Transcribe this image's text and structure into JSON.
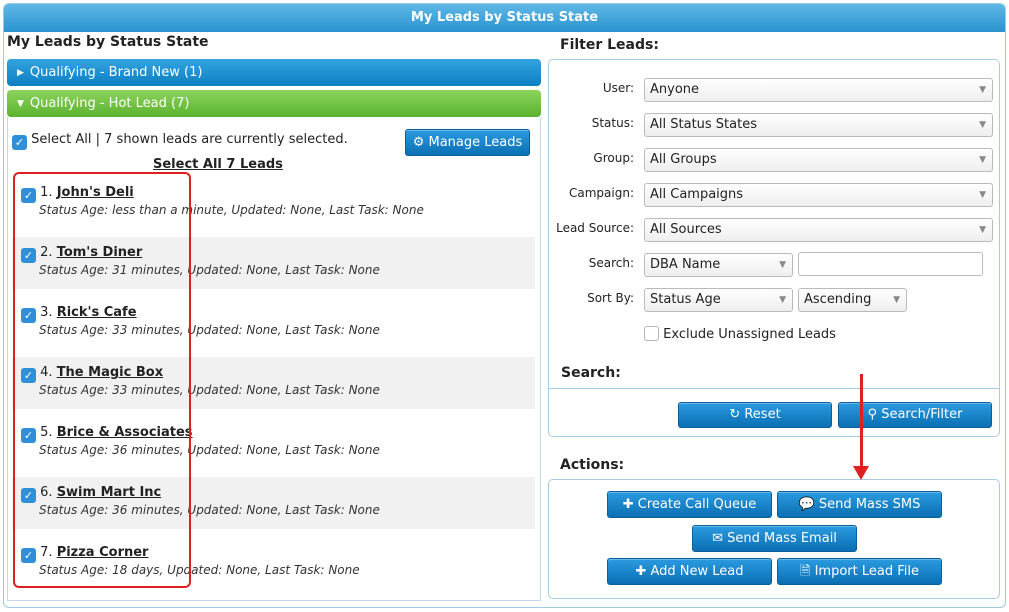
{
  "window": {
    "title": "My Leads by Status State"
  },
  "left": {
    "title": "My Leads by Status State",
    "groups": [
      {
        "label": "Qualifying - Brand New (1)"
      },
      {
        "label": "Qualifying - Hot Lead (7)"
      }
    ],
    "select_all_text": "Select All | 7 shown leads are currently selected.",
    "select_all_link": "Select All 7 Leads",
    "manage_label": "Manage Leads",
    "leads": [
      {
        "num": "1.",
        "name": "John's Deli",
        "status": "Status Age: less than a minute, Updated: None, Last Task: None"
      },
      {
        "num": "2.",
        "name": "Tom's Diner",
        "status": "Status Age: 31 minutes, Updated: None, Last Task: None"
      },
      {
        "num": "3.",
        "name": "Rick's Cafe",
        "status": "Status Age: 33 minutes, Updated: None, Last Task: None"
      },
      {
        "num": "4.",
        "name": "The Magic Box",
        "status": "Status Age: 33 minutes, Updated: None, Last Task: None"
      },
      {
        "num": "5.",
        "name": "Brice & Associates",
        "status": "Status Age: 36 minutes, Updated: None, Last Task: None"
      },
      {
        "num": "6.",
        "name": "Swim Mart Inc",
        "status": "Status Age: 36 minutes, Updated: None, Last Task: None"
      },
      {
        "num": "7.",
        "name": "Pizza Corner",
        "status": "Status Age: 18 days, Updated: None, Last Task: None"
      }
    ]
  },
  "filter": {
    "title": "Filter Leads:",
    "user_label": "User:",
    "user_value": "Anyone",
    "status_label": "Status:",
    "status_value": "All Status States",
    "group_label": "Group:",
    "group_value": "All Groups",
    "campaign_label": "Campaign:",
    "campaign_value": "All Campaigns",
    "source_label": "Lead Source:",
    "source_value": "All Sources",
    "search_label": "Search:",
    "search_field_value": "DBA Name",
    "search_text": "",
    "sort_label": "Sort By:",
    "sort_value": "Status Age",
    "order_value": "Ascending",
    "exclude_label": "Exclude Unassigned Leads",
    "search_section": "Search:",
    "reset_label": "Reset",
    "search_button_label": "Search/Filter"
  },
  "actions": {
    "title": "Actions:",
    "call_queue": "Create Call Queue",
    "mass_sms": "Send Mass SMS",
    "mass_email": "Send Mass Email",
    "add_lead": "Add New Lead",
    "import": "Import Lead File"
  }
}
